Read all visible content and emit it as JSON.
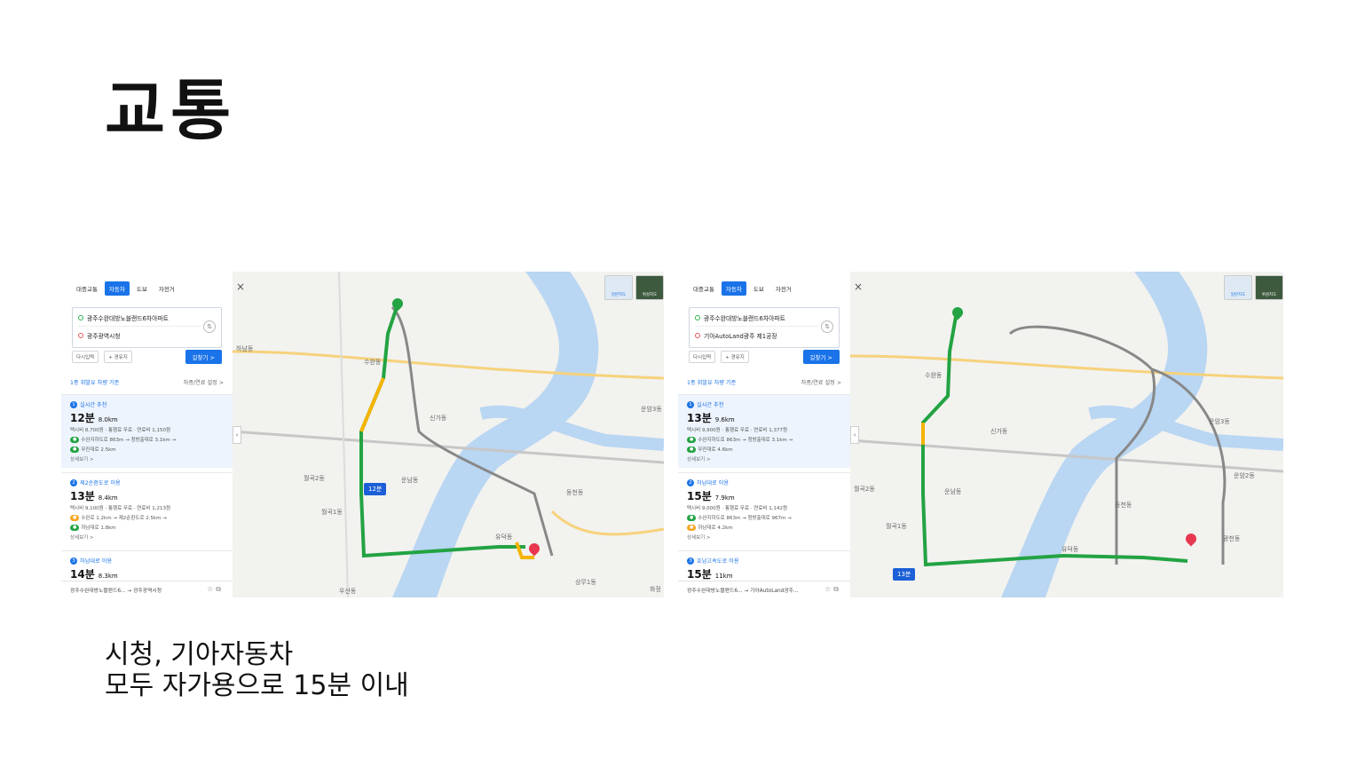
{
  "slide": {
    "title": "교통",
    "caption_line1": "시청, 기아자동차",
    "caption_line2": "모두 자가용으로 15분 이내"
  },
  "shot1": {
    "modes": [
      "대중교통",
      "자동차",
      "도보",
      "자전거"
    ],
    "origin": "광주수완대방노블랜드6차아파트",
    "destination": "광주광역시청",
    "reset_label": "다시입력",
    "waypoint_label": "+ 경유지",
    "search_label": "길찾기 >",
    "condition": "1종 휘발유 차량 기준",
    "condition_setting": "차종/연료 설정 >",
    "routes": [
      {
        "num": "1",
        "tag": "실시간 추천",
        "time": "12분",
        "distance": "8.0km",
        "fee": "택시비 8,700원 · 통행료 무료 · 연료비 1,150원",
        "road1": "수완지하도로 863m → 청방출대로 3.1km →",
        "road2": "무진대로 2.5km",
        "more": "상세보기 >"
      },
      {
        "num": "2",
        "tag": "제2순환도로 이용",
        "time": "13분",
        "distance": "8.4km",
        "fee": "택시비 9,100원 · 통행료 무료 · 연료비 1,213원",
        "road1": "수완로 1.2km → 제2순환도로 2.5km →",
        "road2": "하남대로 1.8km",
        "more": "상세보기 >"
      },
      {
        "num": "3",
        "tag": "하남대로 이용",
        "time": "14분",
        "distance": "8.3km"
      }
    ],
    "footer_route": "광주수완대방노블랜드6... → 광주광역시청",
    "map_badge": "12분",
    "end_label": "도착",
    "start_label": "출발",
    "map_places": [
      "수완동",
      "하남동",
      "신가동",
      "운남동",
      "월곡1동",
      "우산동",
      "동천동",
      "유덕동",
      "상무1동",
      "운암3동",
      "월곡2동",
      "화정"
    ]
  },
  "shot2": {
    "modes": [
      "대중교통",
      "자동차",
      "도보",
      "자전거"
    ],
    "origin": "광주수완대방노블랜드6차아파트",
    "destination": "기아AutoLand광주 제1공장",
    "reset_label": "다시입력",
    "waypoint_label": "+ 경유지",
    "search_label": "길찾기 >",
    "condition": "1종 휘발유 차량 기준",
    "condition_setting": "차종/연료 설정 >",
    "routes": [
      {
        "num": "1",
        "tag": "실시간 추천",
        "time": "13분",
        "distance": "9.6km",
        "fee": "택시비 9,900원 · 통행료 무료 · 연료비 1,377원",
        "road1": "수완지하도로 863m → 청방출대로 3.1km →",
        "road2": "무진대로 4.6km",
        "more": "상세보기 >"
      },
      {
        "num": "2",
        "tag": "하남대로 이용",
        "time": "15분",
        "distance": "7.9km",
        "fee": "택시비 9,000원 · 통행료 무료 · 연료비 1,142원",
        "road1": "수완지하도로 863m → 청방출대로 967m →",
        "road2": "하남대로 4.2km",
        "more": "상세보기 >"
      },
      {
        "num": "3",
        "tag": "호남고속도로 이용",
        "time": "15분",
        "distance": "11km"
      }
    ],
    "footer_route": "광주수완대방노블랜드6... → 기아AutoLand광주...",
    "map_badge": "13분",
    "end_label": "도착",
    "start_label": "출발",
    "map_places": [
      "수완동",
      "신가동",
      "운남동",
      "월곡1동",
      "동천동",
      "유덕동",
      "광천동",
      "운암3동",
      "운암2동",
      "월곡2동"
    ]
  },
  "common": {
    "maptype_normal": "일반지도",
    "maptype_sat": "위성지도",
    "close_icon": "×",
    "collapse_icon": "‹"
  },
  "colors": {
    "accent": "#1a73e8",
    "route_green": "#23a342",
    "route_yellow": "#f5b400",
    "river": "#b9d6f2"
  }
}
